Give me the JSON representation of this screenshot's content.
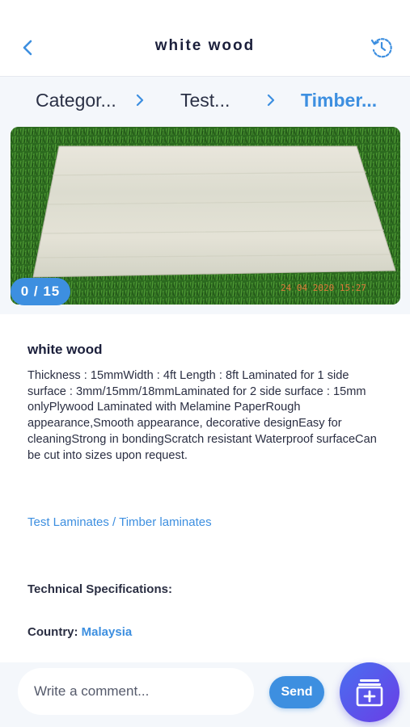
{
  "header": {
    "title": "white wood"
  },
  "breadcrumb": {
    "items": [
      "Categor...",
      "Test...",
      "Timber..."
    ]
  },
  "gallery": {
    "counter": "0 / 15",
    "photo_timestamp": "24 04 2020 15:27"
  },
  "product": {
    "name": "white wood",
    "description": "Thickness : 15mmWidth : 4ft Length : 8ft Laminated for 1 side surface : 3mm/15mm/18mmLaminated for 2 side surface : 15mm onlyPlywood Laminated with Melamine PaperRough appearance,Smooth appearance, decorative designEasy for cleaningStrong in bondingScratch resistant Waterproof surfaceCan be cut into sizes upon request.",
    "category_link": "Test Laminates / Timber laminates",
    "tech_spec_label": "Technical Specifications:",
    "country_label": "Country:",
    "country_value": "Malaysia"
  },
  "comment": {
    "placeholder": "Write a comment...",
    "send_label": "Send"
  },
  "colors": {
    "accent": "#3d8fe0",
    "title": "#1b1f3b",
    "fab_start": "#4a6ef0",
    "fab_end": "#6a3ee6"
  },
  "icons": {
    "back": "chevron-left-icon",
    "history": "history-icon",
    "separator": "chevron-right-icon",
    "fab": "add-to-collection-icon"
  }
}
